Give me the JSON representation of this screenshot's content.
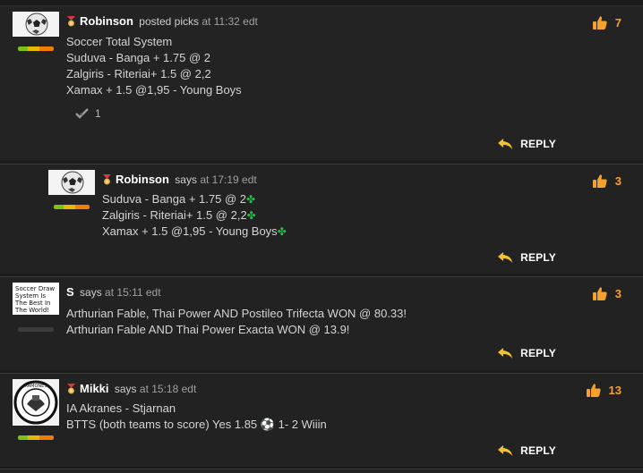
{
  "posts": [
    {
      "user": "Robinson",
      "verb": "posted picks",
      "time_prefix": "at",
      "time": "11:32 edt",
      "likes": "7",
      "lines": [
        "Soccer Total System",
        "Suduva - Banga + 1.75 @ 2",
        "Zalgiris - Riteriai+ 1.5 @ 2,2",
        "Xamax + 1.5 @1,95 - Young Boys"
      ],
      "approvals": "1",
      "reply_label": "REPLY"
    },
    {
      "user": "Robinson",
      "verb": "says",
      "time_prefix": "at",
      "time": "17:19 edt",
      "likes": "3",
      "lines": [
        "Suduva - Banga + 1.75 @ 2",
        "Zalgiris - Riteriai+ 1.5 @ 2,2",
        "Xamax + 1.5 @1,95 - Young Boys"
      ],
      "reply_label": "REPLY"
    },
    {
      "user": "S",
      "verb": "says",
      "time_prefix": "at",
      "time": "15:11 edt",
      "likes": "3",
      "avatar_text": "Soccer Draw System Is The Best In The World!",
      "lines": [
        "Arthurian Fable, Thai Power AND Postileo Trifecta WON @ 80.33!",
        "Arthurian Fable AND Thai Power Exacta WON @ 13.9!"
      ],
      "reply_label": "REPLY"
    },
    {
      "user": "Mikki",
      "verb": "says",
      "time_prefix": "at",
      "time": "15:18 edt",
      "likes": "13",
      "lines": [
        "IA Akranes - Stjarnan",
        "BTTS (both teams to score) Yes 1.85",
        "1- 2 Wiiin"
      ],
      "reply_label": "REPLY"
    }
  ],
  "icons": {
    "medal": "medal-icon",
    "thumb": "thumbs-up-icon",
    "reply": "reply-arrow-icon",
    "check": "checkmark-icon",
    "clover": "four-leaf-clover-icon",
    "ball": "soccer-ball-icon"
  },
  "colors": {
    "background": "#1b1b1b",
    "panel": "#222222",
    "accent": "#f7a12a",
    "clover": "#27b84a"
  }
}
